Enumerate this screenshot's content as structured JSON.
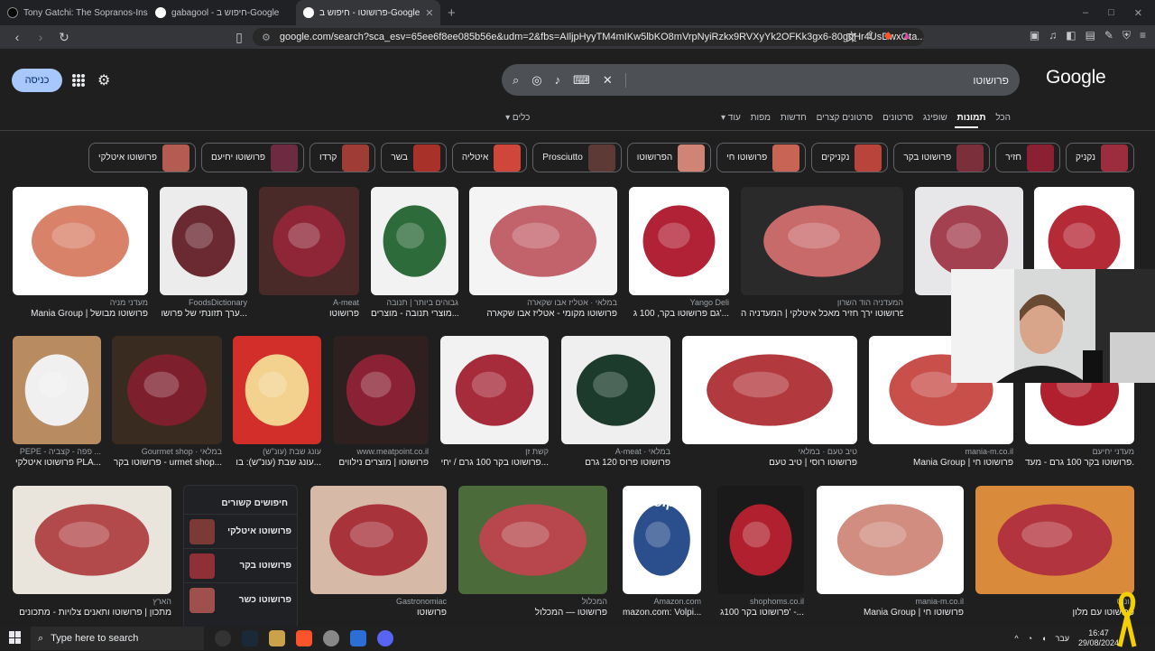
{
  "tabs": [
    {
      "label": "Tony Gatchi: The Sopranos-Inspired !",
      "color": "#ffffff"
    },
    {
      "label": "gabagool - חיפוש ב-Google",
      "color": "#4285f4"
    },
    {
      "label": "פרושוטו - חיפוש ב-Google",
      "color": "#4285f4"
    }
  ],
  "new_tab": "+",
  "window_controls": [
    "–",
    "□",
    "✕"
  ],
  "url": "google.com/search?sca_esv=65ee6f8ee085b56e&udm=2&fbs=AIljpHyyTM4mIKw5lbKO8mVrpNyiRzkx9RVXyYk2OFKk3gx6-80gqHr4UsDwxOta...",
  "header": {
    "signin": "כניסה",
    "logo": "Google",
    "query": "פרושוטו"
  },
  "filters": {
    "all": "הכל",
    "images": "תמונות",
    "shopping": "שופינג",
    "videos": "סרטונים",
    "short_videos": "סרטונים קצרים",
    "news": "חדשות",
    "maps": "מפות",
    "more": "עוד ▾",
    "tools": "כלים ▾"
  },
  "chips": [
    {
      "label": "נקניק",
      "color": "#9b2d3d"
    },
    {
      "label": "חזיר",
      "color": "#8c2033"
    },
    {
      "label": "פרושוטו בקר",
      "color": "#7a2f3a"
    },
    {
      "label": "נקניקים",
      "color": "#b9443b"
    },
    {
      "label": "פרושוטו חי",
      "color": "#c86454"
    },
    {
      "label": "הפרושוטו",
      "color": "#d08476"
    },
    {
      "label": "Prosciutto",
      "color": "#5e3a36"
    },
    {
      "label": "איטליה",
      "color": "#d0463a"
    },
    {
      "label": "בשר",
      "color": "#a8312a"
    },
    {
      "label": "קרדו",
      "color": "#9f3c35"
    },
    {
      "label": "פרושוטו יחיעם",
      "color": "#6c2b40"
    },
    {
      "label": "פרושוטו איטלקי",
      "color": "#b45b52"
    }
  ],
  "row1": [
    {
      "source": "מעדני מניה",
      "title": "Mania Group | פרושוטו מבושל",
      "bg": "#ffffff",
      "fg": "#d9826a"
    },
    {
      "source": "FoodsDictionary",
      "title": "ערך תזונתי של פרושו...",
      "bg": "#ececec",
      "fg": "#6b2a32"
    },
    {
      "source": "A-meat",
      "title": "פרושוטו",
      "bg": "#4a2a28",
      "fg": "#8f2637"
    },
    {
      "source": "גבוהים ביותר | תנובה",
      "title": "מוצרי תנובה - מוצרים...",
      "bg": "#f2f2f2",
      "fg": "#2e6b3a"
    },
    {
      "source": "במלאי · אטליז אבו שקארה",
      "title": "פרושוטו מקומי - אטליז אבו שקארה",
      "bg": "#f4f4f4",
      "fg": "#c2636b"
    },
    {
      "source": "Yango Deli",
      "title": "גם פרושוטו בקר, 100 ג'...",
      "bg": "#ffffff",
      "fg": "#b12236"
    },
    {
      "source": "המעדניה הוד השרון",
      "title": "פרושוטו ירך חזיר מאכל איטלקי | המעדניה ה...",
      "bg": "#2a2a2a",
      "fg": "#c86a6a"
    },
    {
      "source": "",
      "title": "",
      "bg": "#e7e7ea",
      "fg": "#a44150"
    },
    {
      "source": "",
      "title": "",
      "bg": "#ffffff",
      "fg": "#b52a37"
    }
  ],
  "row2": [
    {
      "source": "PEPE - פפה - קצביה ...",
      "title": "פרושוטו איטלקי PLA...",
      "bg": "#b98b61",
      "fg": "#f0f0f0"
    },
    {
      "source": "Gourmet shop · במלאי",
      "title": "פרושוטו בקר - urmet shop...",
      "bg": "#3a2b21",
      "fg": "#7d1f2c"
    },
    {
      "source": "עונג שבת (עונ\"ש)",
      "title": "עונג שבת (עונ\"ש): בו...",
      "bg": "#d22f2a",
      "fg": "#f3d28f"
    },
    {
      "source": "www.meatpoint.co.il",
      "title": "פרושוטו | מוצרים נילווים",
      "bg": "#2f2020",
      "fg": "#8b2134"
    },
    {
      "source": "קשת זן",
      "title": "פרושוטו בקר 100 גרם / יחי...",
      "bg": "#f2f2f2",
      "fg": "#a62b3b"
    },
    {
      "source": "A-meat · במלאי",
      "title": "פרושוטו פרוס 120 גרם",
      "bg": "#efefef",
      "fg": "#1c3b2c"
    },
    {
      "source": "טיב טעם · במלאי",
      "title": "פרושוטו רוסי | טיב טעם",
      "bg": "#ffffff",
      "fg": "#b23a3f"
    },
    {
      "source": "mania-m.co.il",
      "title": "Mania Group | פרושוטו חי",
      "bg": "#ffffff",
      "fg": "#c94f4b"
    },
    {
      "source": "מעדני יחיעם",
      "title": "פרושוטו בקר 100 גרם - מעד...",
      "bg": "#ffffff",
      "fg": "#b0202e"
    }
  ],
  "row3": [
    {
      "source": "הארץ",
      "title": "מתכון | פרושוטו ותאנים צלויות - מתכונים",
      "bg": "#e9e4dc",
      "fg": "#b2494b"
    },
    {
      "source": "Gastronomiac",
      "title": "פרושוטו",
      "bg": "#d7b9a8",
      "fg": "#a8333b"
    },
    {
      "source": "המכלול",
      "title": "פרושוטו — המכלול",
      "bg": "#4b6b3a",
      "fg": "#b7474c"
    },
    {
      "source": "Amazon.com",
      "title": "mazon.com: Volpi...",
      "bg": "#ffffff",
      "fg": "#2a4f8c",
      "label": "Volpi"
    },
    {
      "source": "shophoms.co.il",
      "title": "פרושוטו בקר 100ג' -...",
      "bg": "#1a1a1a",
      "fg": "#b0202e"
    },
    {
      "source": "mania-m.co.il",
      "title": "Mania Group | פרושוטו חי",
      "bg": "#ffffff",
      "fg": "#d08d80"
    },
    {
      "source": "קונוס",
      "title": "פרושוטו עם מלון",
      "bg": "#d98b3b",
      "fg": "#b2343e"
    }
  ],
  "related": {
    "title": "חיפושים קשורים",
    "items": [
      "פרושוטו איטלקי",
      "פרושוטו בקר",
      "פרושוטו כשר"
    ]
  },
  "taskbar": {
    "search": "Type here to search",
    "time": "16:47",
    "date": "29/08/2024",
    "lang": "עבר"
  }
}
